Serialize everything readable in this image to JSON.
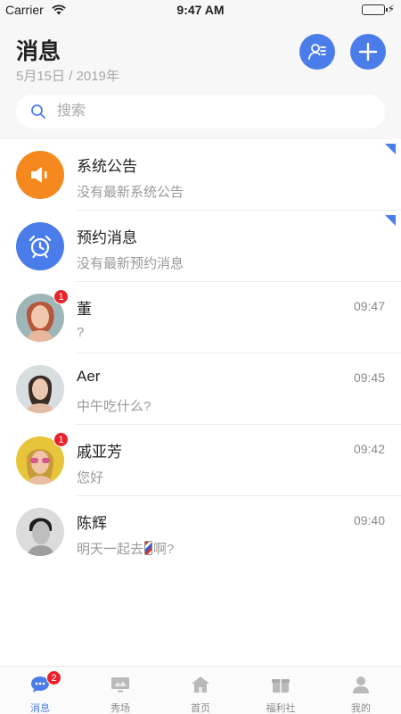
{
  "status_bar": {
    "carrier": "Carrier",
    "time": "9:47 AM"
  },
  "header": {
    "title": "消息",
    "date": "5月15日 / 2019年",
    "search_placeholder": "搜索"
  },
  "conversations": [
    {
      "name": "系统公告",
      "preview": "没有最新系统公告",
      "time": "",
      "avatar": "speaker-icon",
      "avatar_color": "#f5891f",
      "pinned": true
    },
    {
      "name": "预约消息",
      "preview": "没有最新预约消息",
      "time": "",
      "avatar": "alarm-clock-icon",
      "avatar_color": "#4a7de9",
      "pinned": true
    },
    {
      "name": "董",
      "preview": "?",
      "time": "09:47",
      "avatar": "user-photo",
      "badge": "1"
    },
    {
      "name": "Aer",
      "preview": "中午吃什么?",
      "time": "09:45",
      "avatar": "user-photo"
    },
    {
      "name": "戚亚芳",
      "preview": "您好",
      "time": "09:42",
      "avatar": "user-photo",
      "badge": "1"
    },
    {
      "name": "陈辉",
      "preview_before": "明天一起去",
      "preview_after": "啊?",
      "preview_emoji": "barber-pole",
      "time": "09:40",
      "avatar": "user-photo"
    }
  ],
  "tabbar": {
    "items": [
      {
        "label": "消息",
        "icon": "chat-icon",
        "active": true,
        "badge": "2"
      },
      {
        "label": "秀场",
        "icon": "screen-icon"
      },
      {
        "label": "首页",
        "icon": "home-icon"
      },
      {
        "label": "福利社",
        "icon": "gift-icon"
      },
      {
        "label": "我的",
        "icon": "profile-icon"
      }
    ]
  },
  "colors": {
    "accent": "#4a7de9",
    "orange": "#f5891f",
    "badge": "#e8232b"
  }
}
